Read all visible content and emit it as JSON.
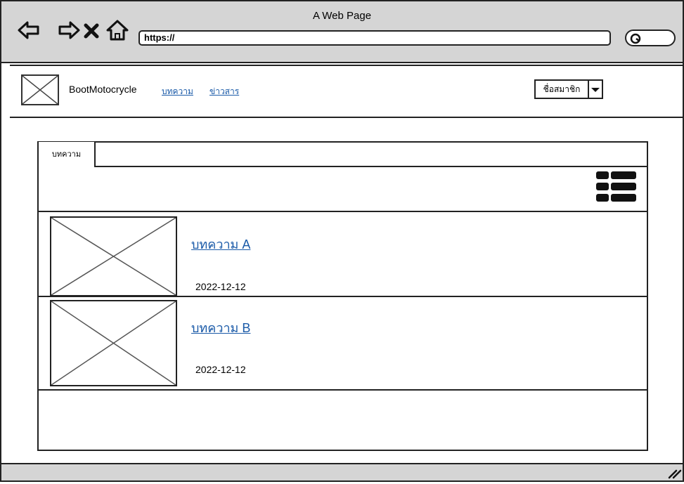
{
  "window": {
    "title": "A Web Page"
  },
  "browser": {
    "nav_icons": [
      "back-arrow-icon",
      "forward-arrow-icon",
      "close-x-icon",
      "home-icon"
    ],
    "url": "https://",
    "search_icon": "search-icon"
  },
  "header": {
    "brand": "BootMotocrycle",
    "nav": [
      {
        "label": "บทความ"
      },
      {
        "label": "ข่าวสาร"
      }
    ],
    "user_menu": {
      "label": "ชื่อสมาชิก"
    }
  },
  "content": {
    "tab_label": "บทความ",
    "view_icon": "list-view-icon",
    "articles": [
      {
        "title": "บทความ A",
        "date": "2022-12-12"
      },
      {
        "title": "บทความ B",
        "date": "2022-12-12"
      }
    ]
  },
  "colors": {
    "link": "#1a5aa8",
    "chrome": "#d5d5d5"
  }
}
